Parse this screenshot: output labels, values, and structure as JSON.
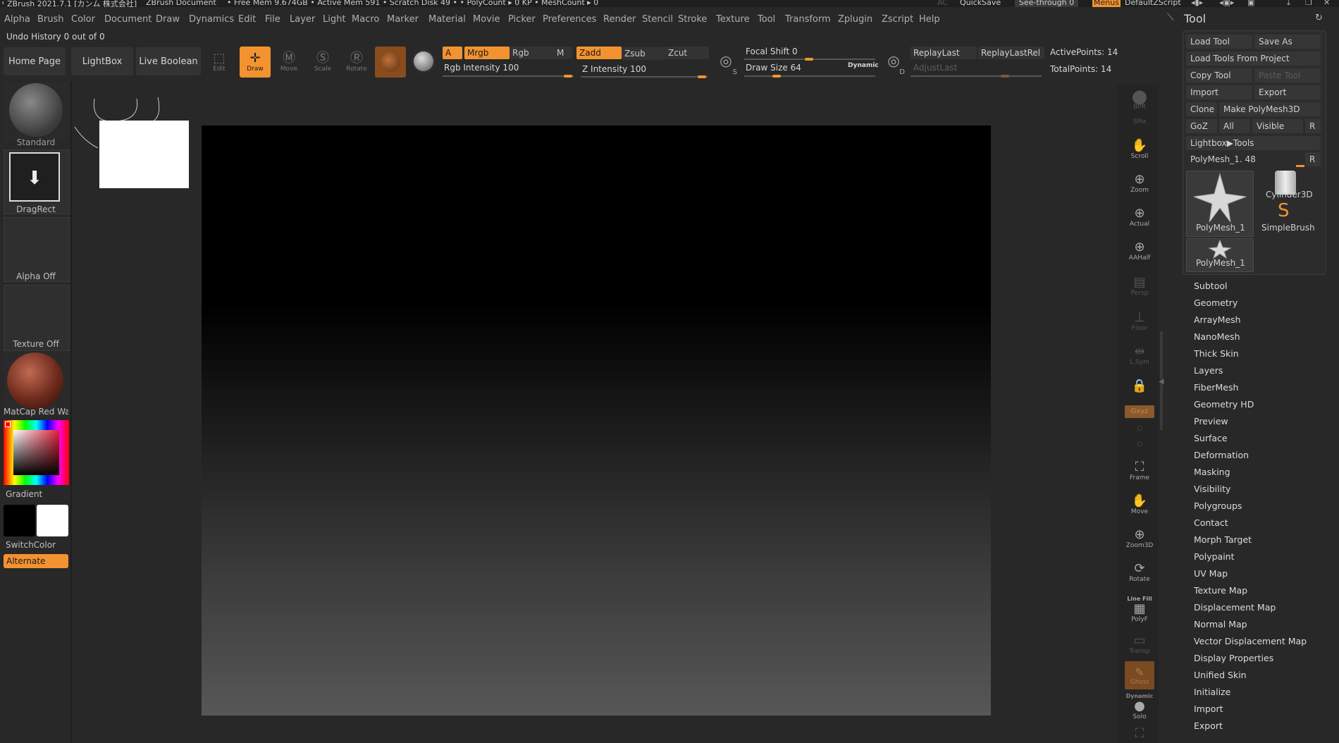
{
  "titlebar": {
    "app": "ZBrush 2021.7.1 [カンム 株式会社]",
    "doc": "ZBrush Document",
    "stats": "• Free Mem 9.674GB • Active Mem 591 • Scratch Disk 49 • • PolyCount ▸ 0 KP • MeshCount ▸ 0",
    "ac": "AC",
    "quicksave": "QuickSave",
    "seethrough": "See-through 0",
    "menus": "Menus",
    "defaultzscript": "DefaultZScript"
  },
  "menubar": {
    "items": [
      "Alpha",
      "Brush",
      "Color",
      "Document",
      "Draw",
      "Dynamics",
      "Edit",
      "File",
      "Layer",
      "Light",
      "Macro",
      "Marker",
      "Material",
      "Movie",
      "Picker",
      "Preferences",
      "Render",
      "Stencil",
      "Stroke",
      "Texture",
      "Tool",
      "Transform",
      "Zplugin",
      "Zscript",
      "Help"
    ]
  },
  "undo_history": "Undo History 0 out of 0",
  "toolbar": {
    "home_page": "Home Page",
    "lightbox": "LightBox",
    "live_boolean": "Live Boolean",
    "edit": "Edit",
    "draw": "Draw",
    "move": "Move",
    "scale": "Scale",
    "rotate": "Rotate",
    "a": "A",
    "mrgb": "Mrgb",
    "rgb": "Rgb",
    "m": "M",
    "zadd": "Zadd",
    "zsub": "Zsub",
    "zcut": "Zcut",
    "rgb_intensity": "Rgb Intensity 100",
    "z_intensity": "Z Intensity 100",
    "focal_shift": "Focal Shift 0",
    "draw_size": "Draw Size 64",
    "dynamic": "Dynamic",
    "replay_last": "ReplayLast",
    "replay_last_rel": "ReplayLastRel",
    "adjust_last": "AdjustLast",
    "active_points": "ActivePoints: 14",
    "total_points": "TotalPoints: 14",
    "s_label": "S",
    "d_label": "D"
  },
  "left_panel": {
    "standard": "Standard",
    "dragrect": "DragRect",
    "alpha_off": "Alpha Off",
    "texture_off": "Texture Off",
    "matcap": "MatCap Red Wax",
    "gradient": "Gradient",
    "switchcolor": "SwitchColor",
    "alternate": "Alternate"
  },
  "right_shelf": {
    "bpr": "BPR",
    "spix": "SPix",
    "scroll": "Scroll",
    "zoom": "Zoom",
    "actual": "Actual",
    "aahalf": "AAHalf",
    "persp": "Persp",
    "floor": "Floor",
    "lsym": "L.Sym",
    "gxyz": "Gxyz",
    "frame": "Frame",
    "move": "Move",
    "zoom3d": "Zoom3D",
    "rotate": "Rotate",
    "linefill": "Line Fill",
    "polyf": "PolyF",
    "transp": "Transp",
    "ghost": "Ghost",
    "dynamic": "Dynamic",
    "solo": "Solo"
  },
  "tool_panel": {
    "title": "Tool",
    "load_tool": "Load Tool",
    "save_as": "Save As",
    "load_from_project": "Load Tools From Project",
    "copy_tool": "Copy Tool",
    "paste_tool": "Paste Tool",
    "import": "Import",
    "export": "Export",
    "clone": "Clone",
    "make_polymesh": "Make PolyMesh3D",
    "goz": "GoZ",
    "all": "All",
    "visible": "Visible",
    "r": "R",
    "lightbox_tools": "Lightbox▶Tools",
    "polymesh_slider": "PolyMesh_1. 48",
    "thumb1": "PolyMesh_1",
    "thumb2": "Cylinder3D",
    "thumb3": "SimpleBrush",
    "thumb4": "PolyMesh_1"
  },
  "tool_subpalettes": [
    "Subtool",
    "Geometry",
    "ArrayMesh",
    "NanoMesh",
    "Thick Skin",
    "Layers",
    "FiberMesh",
    "Geometry HD",
    "Preview",
    "Surface",
    "Deformation",
    "Masking",
    "Visibility",
    "Polygroups",
    "Contact",
    "Morph Target",
    "Polypaint",
    "UV Map",
    "Texture Map",
    "Displacement Map",
    "Normal Map",
    "Vector Displacement Map",
    "Display Properties",
    "Unified Skin",
    "Initialize",
    "Import",
    "Export"
  ],
  "colors": {
    "accent": "#f29330",
    "canvas_top": "#000000",
    "canvas_bottom": "#575757",
    "background": "#282828"
  }
}
